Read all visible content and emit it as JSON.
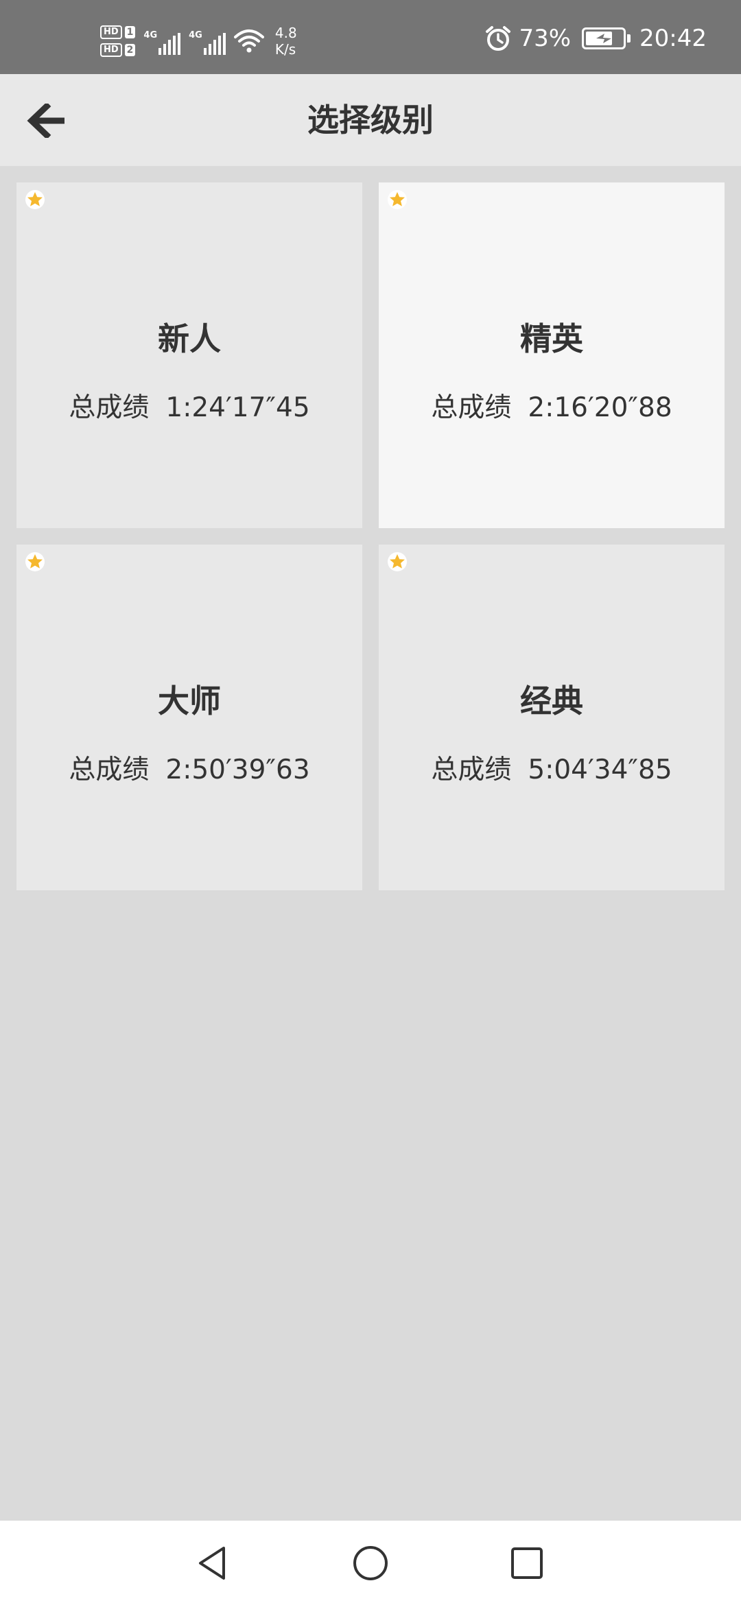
{
  "status_bar": {
    "sim1_hd": "HD",
    "sim1_num": "1",
    "sim2_hd": "HD",
    "sim2_num": "2",
    "network_1": "4G",
    "network_2": "4G",
    "speed_value": "4.8",
    "speed_unit": "K/s",
    "battery_percent": "73%",
    "battery_level": 0.73,
    "time": "20:42"
  },
  "header": {
    "title": "选择级别",
    "back_icon": "arrow-left-icon"
  },
  "levels": [
    {
      "name": "新人",
      "score_label": "总成绩",
      "score": "1:24′17″45",
      "selected": false
    },
    {
      "name": "精英",
      "score_label": "总成绩",
      "score": "2:16′20″88",
      "selected": true
    },
    {
      "name": "大师",
      "score_label": "总成绩",
      "score": "2:50′39″63",
      "selected": false
    },
    {
      "name": "经典",
      "score_label": "总成绩",
      "score": "5:04′34″85",
      "selected": false
    }
  ],
  "colors": {
    "status_bar": "#757575",
    "header": "#e8e8e8",
    "background": "#dadada",
    "card": "#e8e8e8",
    "card_selected": "#f6f6f6",
    "star": "#f5b82e"
  },
  "nav": {
    "back_icon": "triangle-back-icon",
    "home_icon": "circle-home-icon",
    "recents_icon": "square-recents-icon"
  }
}
